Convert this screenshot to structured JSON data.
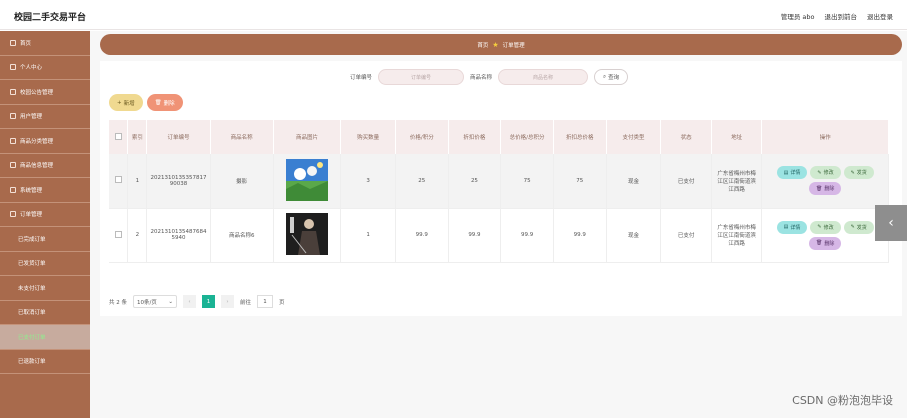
{
  "header": {
    "title": "校园二手交易平台",
    "links": [
      "管理员 abo",
      "退出到前台",
      "退出登录"
    ]
  },
  "sidebar": {
    "items": [
      {
        "label": "首页",
        "sub": false,
        "active": false
      },
      {
        "label": "个人中心",
        "sub": false,
        "active": false
      },
      {
        "label": "校园公告管理",
        "sub": false,
        "active": false
      },
      {
        "label": "用户管理",
        "sub": false,
        "active": false
      },
      {
        "label": "商品分类管理",
        "sub": false,
        "active": false
      },
      {
        "label": "商品信息管理",
        "sub": false,
        "active": false
      },
      {
        "label": "系统管理",
        "sub": false,
        "active": false
      },
      {
        "label": "订单管理",
        "sub": false,
        "active": false
      },
      {
        "label": "已完成订单",
        "sub": true,
        "active": false
      },
      {
        "label": "已发货订单",
        "sub": true,
        "active": false
      },
      {
        "label": "未支付订单",
        "sub": true,
        "active": false
      },
      {
        "label": "已取消订单",
        "sub": true,
        "active": false
      },
      {
        "label": "已支付订单",
        "sub": true,
        "active": true
      },
      {
        "label": "已退款订单",
        "sub": true,
        "active": false
      }
    ]
  },
  "breadcrumb": {
    "home": "首页",
    "current": "订单管理"
  },
  "search": {
    "order_label": "订单编号",
    "order_placeholder": "订单编号",
    "name_label": "商品名称",
    "name_placeholder": "商品名称",
    "query_label": "查询"
  },
  "toolbar": {
    "add_label": "新增",
    "delete_label": "删除"
  },
  "table": {
    "headers": [
      "索引",
      "订单编号",
      "商品名称",
      "商品图片",
      "购买数量",
      "价格/积分",
      "折扣价格",
      "总价格/总积分",
      "折扣总价格",
      "支付类型",
      "状态",
      "地址",
      "操作"
    ],
    "rows": [
      {
        "index": "1",
        "order_no": "202131013535781790038",
        "name": "摄影",
        "qty": "3",
        "price": "25",
        "discount": "25",
        "total": "75",
        "discount_total": "75",
        "pay_type": "现金",
        "status": "已支付",
        "address": "广东省梅州市梅江区江南街道滨江西路"
      },
      {
        "index": "2",
        "order_no": "20213101354876845940",
        "name": "商品名称6",
        "qty": "1",
        "price": "99.9",
        "discount": "99.9",
        "total": "99.9",
        "discount_total": "99.9",
        "pay_type": "现金",
        "status": "已支付",
        "address": "广东省梅州市梅江区江南街道滨江西路"
      }
    ],
    "ops": {
      "detail": "详情",
      "edit": "修改",
      "ship": "发货",
      "del": "删除"
    }
  },
  "pager": {
    "total": "共 2 条",
    "page_size": "10条/页",
    "current": "1",
    "goto_label": "前往",
    "goto_value": "1",
    "page_unit": "页"
  },
  "watermark": "CSDN @粉泡泡毕设"
}
